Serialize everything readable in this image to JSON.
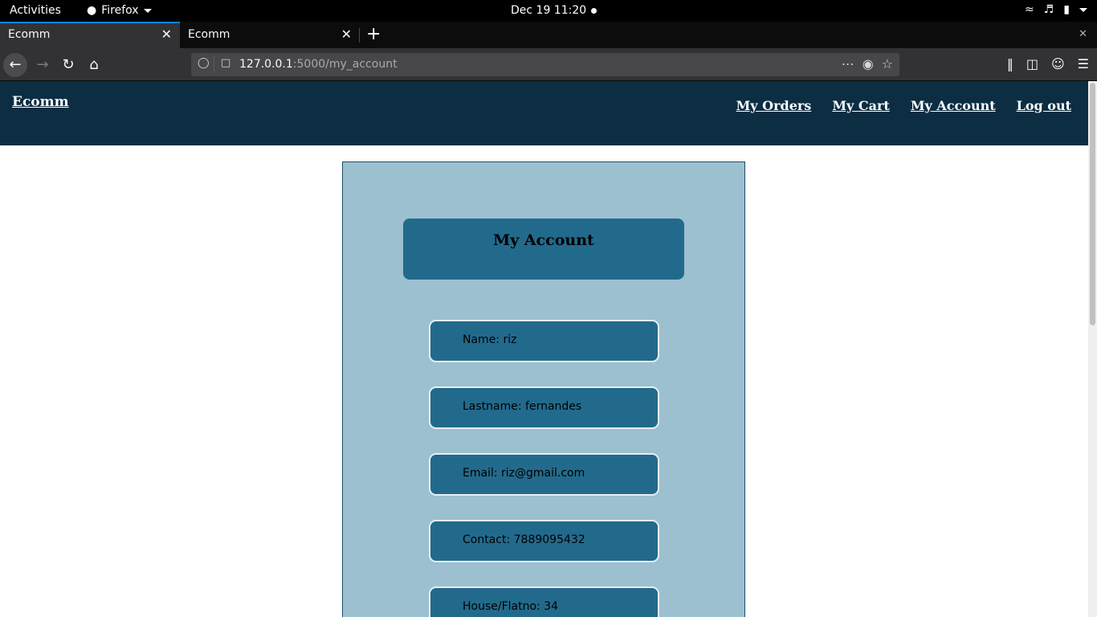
{
  "os_topbar": {
    "activities": "Activities",
    "app_name": "Firefox",
    "clock": "Dec 19  11:20"
  },
  "browser": {
    "tabs": [
      {
        "title": "Ecomm",
        "active": true
      },
      {
        "title": "Ecomm",
        "active": false
      }
    ],
    "url_host": "127.0.0.1",
    "url_rest": ":5000/my_account"
  },
  "site": {
    "brand": "Ecomm",
    "nav": [
      "My Orders",
      "My Cart",
      "My Account",
      "Log out"
    ],
    "colors": {
      "header_bg": "#0c2d42",
      "panel_bg": "#9cc0cf",
      "field_bg": "#226a8c"
    }
  },
  "account": {
    "title": "My Account",
    "fields": [
      "Name: riz",
      "Lastname: fernandes",
      "Email: riz@gmail.com",
      "Contact: 7889095432",
      "House/Flatno: 34"
    ]
  }
}
